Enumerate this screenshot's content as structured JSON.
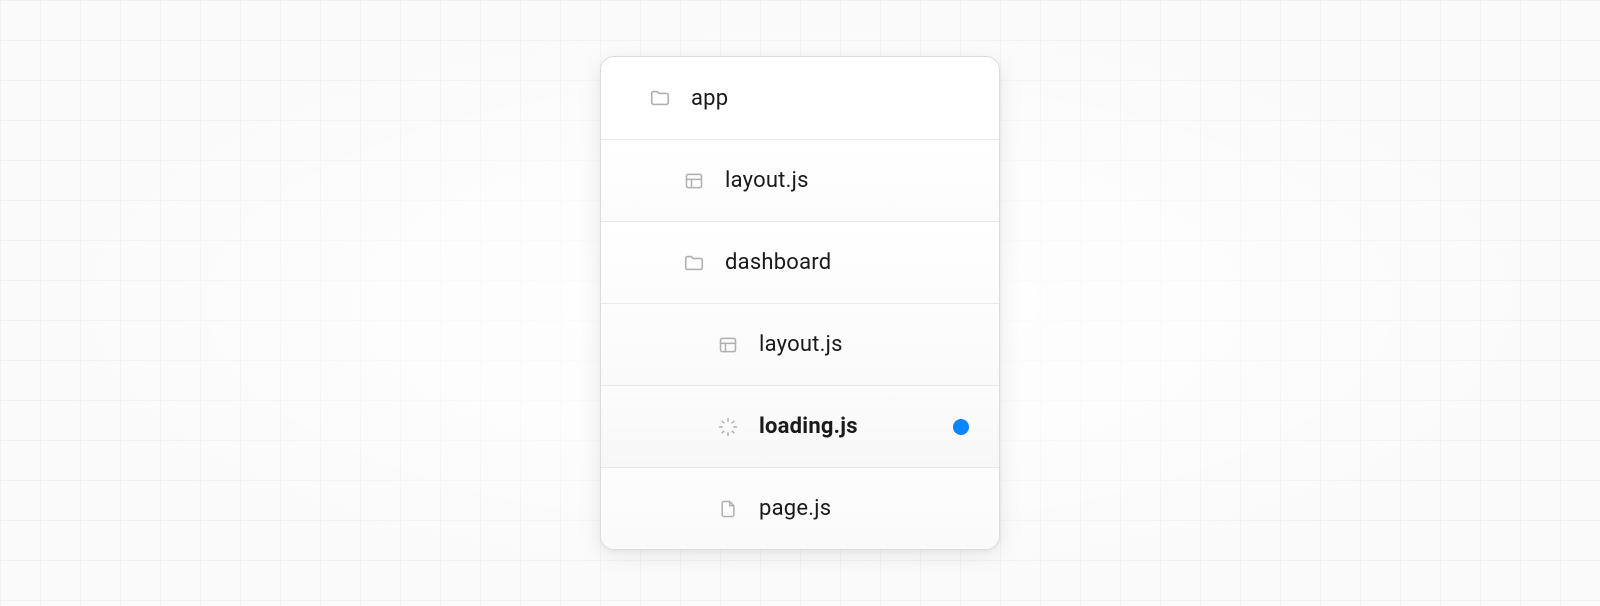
{
  "tree": {
    "root": {
      "label": "app",
      "icon": "folder"
    },
    "items": [
      {
        "label": "layout.js",
        "icon": "layout",
        "depth": 1,
        "bold": false,
        "marker": false
      },
      {
        "label": "dashboard",
        "icon": "folder",
        "depth": 1,
        "bold": false,
        "marker": false
      },
      {
        "label": "layout.js",
        "icon": "layout",
        "depth": 2,
        "bold": false,
        "marker": false
      },
      {
        "label": "loading.js",
        "icon": "spinner",
        "depth": 2,
        "bold": true,
        "marker": true
      },
      {
        "label": "page.js",
        "icon": "file",
        "depth": 2,
        "bold": false,
        "marker": false
      }
    ],
    "marker_color": "#0a84ff"
  }
}
